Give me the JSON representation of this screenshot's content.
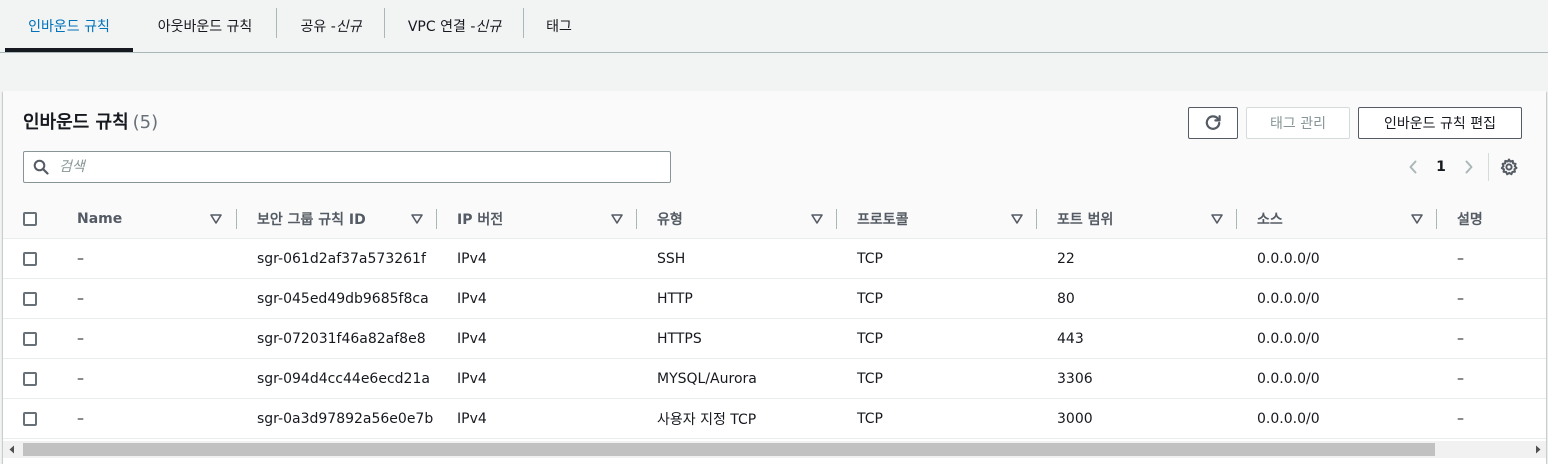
{
  "tabs": [
    {
      "label": "인바운드 규칙",
      "suffix": "",
      "active": true
    },
    {
      "label": "아웃바운드 규칙",
      "suffix": ""
    },
    {
      "label": "공유 - ",
      "suffix": "신규"
    },
    {
      "label": "VPC 연결 - ",
      "suffix": "신규"
    },
    {
      "label": "태그",
      "suffix": ""
    }
  ],
  "panel": {
    "title": "인바운드 규칙",
    "count": "(5)",
    "refresh_icon": "refresh-icon",
    "manage_tags_label": "태그 관리",
    "edit_rules_label": "인바운드 규칙 편집"
  },
  "search": {
    "placeholder": "검색",
    "value": ""
  },
  "pagination": {
    "current_page": "1"
  },
  "table": {
    "columns": [
      "Name",
      "보안 그룹 규칙 ID",
      "IP 버전",
      "유형",
      "프로토콜",
      "포트 범위",
      "소스",
      "설명"
    ],
    "rows": [
      {
        "name": "–",
        "rule_id": "sgr-061d2af37a573261f",
        "ip_version": "IPv4",
        "type": "SSH",
        "protocol": "TCP",
        "port_range": "22",
        "source": "0.0.0.0/0",
        "description": "–"
      },
      {
        "name": "–",
        "rule_id": "sgr-045ed49db9685f8ca",
        "ip_version": "IPv4",
        "type": "HTTP",
        "protocol": "TCP",
        "port_range": "80",
        "source": "0.0.0.0/0",
        "description": "–"
      },
      {
        "name": "–",
        "rule_id": "sgr-072031f46a82af8e8",
        "ip_version": "IPv4",
        "type": "HTTPS",
        "protocol": "TCP",
        "port_range": "443",
        "source": "0.0.0.0/0",
        "description": "–"
      },
      {
        "name": "–",
        "rule_id": "sgr-094d4cc44e6ecd21a",
        "ip_version": "IPv4",
        "type": "MYSQL/Aurora",
        "protocol": "TCP",
        "port_range": "3306",
        "source": "0.0.0.0/0",
        "description": "–"
      },
      {
        "name": "–",
        "rule_id": "sgr-0a3d97892a56e0e7b",
        "ip_version": "IPv4",
        "type": "사용자 지정 TCP",
        "protocol": "TCP",
        "port_range": "3000",
        "source": "0.0.0.0/0",
        "description": "–"
      }
    ]
  },
  "colors": {
    "active_tab": "#0073bb",
    "border": "#aab7b8",
    "text": "#16191f",
    "muted": "#687078"
  }
}
